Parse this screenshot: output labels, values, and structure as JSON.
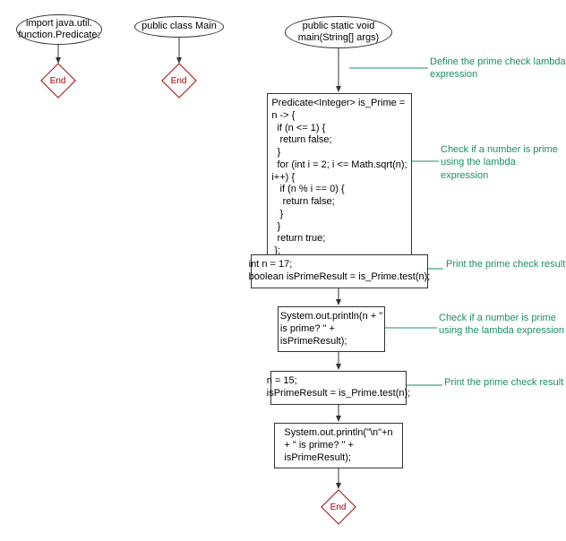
{
  "chart_data": {
    "type": "flowchart",
    "title": "",
    "nodes": [
      {
        "id": "n_import",
        "shape": "ellipse",
        "text": "import java.util.\nfunction.Predicate;"
      },
      {
        "id": "end1",
        "shape": "terminator",
        "text": "End"
      },
      {
        "id": "n_class",
        "shape": "ellipse",
        "text": "public class Main"
      },
      {
        "id": "end2",
        "shape": "terminator",
        "text": "End"
      },
      {
        "id": "n_main",
        "shape": "ellipse",
        "text": "public static void\nmain(String[] args)"
      },
      {
        "id": "n_lambda",
        "shape": "rect",
        "text": "Predicate<Integer> is_Prime =\nn -> {\n  if (n <= 1) {\n   return false;\n  }\n  for (int i = 2; i <= Math.sqrt(n);\ni++) {\n   if (n % i == 0) {\n    return false;\n   }\n  }\n  return true;\n };"
      },
      {
        "id": "n_test1",
        "shape": "rect",
        "text": "int n = 17;\nboolean isPrimeResult = is_Prime.test(n);"
      },
      {
        "id": "n_print1",
        "shape": "rect",
        "text": "System.out.println(n + \"\nis prime? \" +\nisPrimeResult);"
      },
      {
        "id": "n_test2",
        "shape": "rect",
        "text": "n = 15;\nisPrimeResult = is_Prime.test(n);"
      },
      {
        "id": "n_print2",
        "shape": "rect",
        "text": "System.out.println(\"\\n\"+n\n+ \" is prime? \" +\nisPrimeResult);"
      },
      {
        "id": "end3",
        "shape": "terminator",
        "text": "End"
      }
    ],
    "annotations": [
      {
        "id": "a1",
        "text": "Define the prime check\nlambda expression"
      },
      {
        "id": "a2",
        "text": "Check if a number is prime\nusing the lambda\nexpression"
      },
      {
        "id": "a3",
        "text": "Print the prime\ncheck result"
      },
      {
        "id": "a4",
        "text": "Check if a number is prime\nusing the lambda\nexpression"
      },
      {
        "id": "a5",
        "text": "Print the prime\ncheck result"
      }
    ],
    "edges": [
      {
        "from": "n_import",
        "to": "end1"
      },
      {
        "from": "n_class",
        "to": "end2"
      },
      {
        "from": "n_main",
        "to": "n_lambda",
        "label": "a1"
      },
      {
        "from": "n_lambda",
        "to": "n_test1",
        "label": "a2"
      },
      {
        "from": "n_test1",
        "to": "n_print1",
        "label": "a3"
      },
      {
        "from": "n_print1",
        "to": "n_test2",
        "label": "a4"
      },
      {
        "from": "n_test2",
        "to": "n_print2",
        "label": "a5"
      },
      {
        "from": "n_print2",
        "to": "end3"
      }
    ]
  }
}
